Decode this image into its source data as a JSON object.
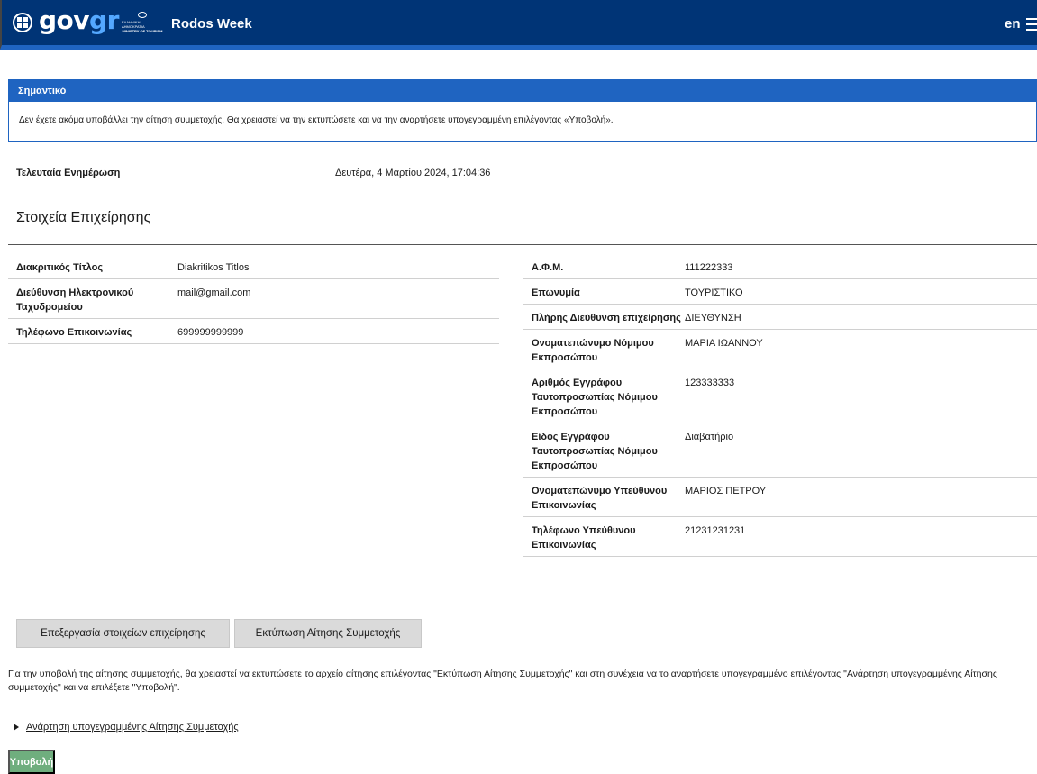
{
  "header": {
    "logo_main": "gov",
    "logo_accent": "gr",
    "ministry_line1": "ΕΛΛΗΝΙΚΗ ΔΗΜΟΚΡΑΤΙΑ",
    "ministry_line2": "MINISTRY OF TOURISM",
    "app_title": "Rodos Week",
    "language": "en",
    "icons": [
      "gov-emblem-icon",
      "ministry-seal-icon",
      "hamburger-menu-icon"
    ],
    "brand_color": "#003476"
  },
  "alert": {
    "title": "Σημαντικό",
    "message": "Δεν έχετε ακόμα υποβάλλει την αίτηση συμμετοχής. Θα χρειαστεί να την εκτυπώσετε και να την αναρτήσετε υπογεγραμμένη επιλέγοντας «Υποβολή».",
    "color": "#1f64c1"
  },
  "last_update": {
    "label": "Τελευταία Ενημέρωση",
    "value": "Δευτέρα, 4 Μαρτίου 2024, 17:04:36"
  },
  "business": {
    "section_title": "Στοιχεία Επιχείρησης",
    "left": [
      {
        "label": "Διακριτικός Τίτλος",
        "value": "Diakritikos Titlos"
      },
      {
        "label": "Διεύθυνση Ηλεκτρονικού Ταχυδρομείου",
        "value": "mail@gmail.com"
      },
      {
        "label": "Τηλέφωνο Επικοινωνίας",
        "value": "699999999999"
      }
    ],
    "right": [
      {
        "label": "Α.Φ.Μ.",
        "value": "111222333"
      },
      {
        "label": "Επωνυμία",
        "value": "ΤΟΥΡΙΣΤΙΚΟ"
      },
      {
        "label": "Πλήρης Διεύθυνση επιχείρησης",
        "value": "ΔΙΕΥΘΥΝΣΗ"
      },
      {
        "label": "Ονοματεπώνυμο Νόμιμου Εκπροσώπου",
        "value": "ΜΑΡΙΑ ΙΩΑΝΝΟΥ"
      },
      {
        "label": "Αριθμός Εγγράφου Ταυτοπροσωπίας Νόμιμου Εκπροσώπου",
        "value": "123333333"
      },
      {
        "label": "Είδος Εγγράφου Ταυτοπροσωπίας Νόμιμου Εκπροσώπου",
        "value": "Διαβατήριο"
      },
      {
        "label": "Ονοματεπώνυμο Υπεύθυνου Επικοινωνίας",
        "value": "ΜΑΡΙΟΣ ΠΕΤΡΟΥ"
      },
      {
        "label": "Τηλέφωνο Υπεύθυνου Επικοινωνίας",
        "value": "21231231231"
      }
    ]
  },
  "actions": {
    "edit_label": "Επεξεργασία στοιχείων επιχείρησης",
    "print_label": "Εκτύπωση Αίτησης Συμμετοχής"
  },
  "instructions": "Για την υποβολή της αίτησης συμμετοχής, θα χρειαστεί να εκτυπώσετε το αρχείο αίτησης επιλέγοντας \"Εκτύπωση Αίτησης Συμμετοχής\" και στη συνέχεια να το αναρτήσετε υπογεγραμμένο επιλέγοντας \"Ανάρτηση υπογεγραμμένης Αίτησης συμμετοχής\" και να επιλέξετε \"Υποβολή\".",
  "upload": {
    "label": "Ανάρτηση υπογεγραμμένης Αίτησης Συμμετοχής"
  },
  "submit": {
    "label": "Υποβολή",
    "color": "#6fae7e"
  }
}
